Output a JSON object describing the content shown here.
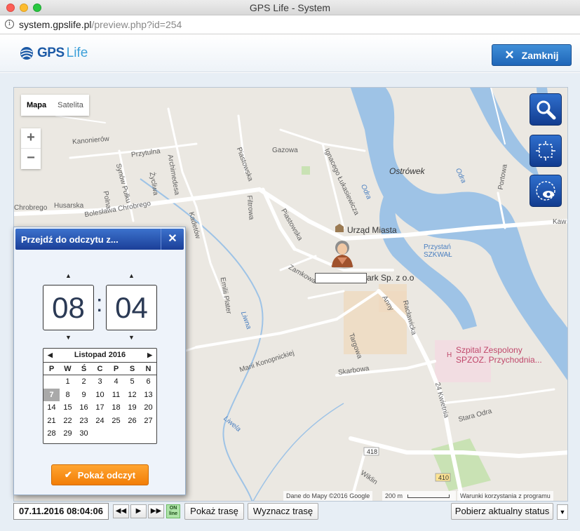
{
  "window": {
    "title": "GPS Life - System"
  },
  "browser": {
    "url_host": "system.gpslife.pl",
    "url_path": "/preview.php?id=254"
  },
  "header": {
    "logo_gps": "GPS",
    "logo_life": "Life",
    "close_label": "Zamknij"
  },
  "map": {
    "type_tabs": [
      "Mapa",
      "Satelita"
    ],
    "active_tab": "Mapa",
    "zoom_in": "+",
    "zoom_out": "−",
    "labels": {
      "kanonierow": "Kanonierów",
      "przytulna": "Przytulna",
      "archimedesa": "Archimedesa",
      "synow_pulku": "Synów Pułku",
      "zycliwa": "Życliwa",
      "piastowska": "Piastowska",
      "gazowa": "Gazowa",
      "ignacego": "Ignacego Łukasiewicza",
      "ostrowek": "Ostrówek",
      "odra": "Odra",
      "odra2": "Odra",
      "portowa": "Portowa",
      "chrobrego": "Chrobrego",
      "husarska": "Husarska",
      "polna": "Polna",
      "boleslawa": "Bolesława Chrobrego",
      "filtrowa": "Filtrowa",
      "kadetow": "Kadetów",
      "piastowska2": "Piastowska",
      "urzad": "Urząd Miasta",
      "przystan": "Przystań",
      "szkwal": "SZKWAŁ",
      "zamkowa": "Zamkowa",
      "park": "ark Sp. z o.o",
      "anny": "Anny",
      "raclawicka": "Racławicka",
      "emilii": "Emilii Plater",
      "liwna": "Liwna",
      "maria": "Marii Konopnickiej",
      "targowa": "Targowa",
      "szpital1": "Szpital Zespolony",
      "szpital2": "SPZOZ. Przychodnia...",
      "skarbowa": "Skarbowa",
      "kwietnia": "24 Kwietnia",
      "stara_odra": "Stara Odra",
      "liwela": "Liwela",
      "wiklinowa": "Wiklin",
      "droga418": "418",
      "droga410": "410",
      "kaw": "Kaw"
    },
    "attribution": "Dane do Mapy ©2016 Google",
    "scale": "200 m",
    "terms": "Warunki korzystania z programu",
    "tool_icons": [
      "search-icon",
      "select-area-icon",
      "view-area-icon"
    ],
    "colors": {
      "water": "#9ec3e6",
      "road": "#ffffff",
      "land": "#ebe8e2"
    }
  },
  "panel": {
    "title": "Przejdź do odczytu z...",
    "hour": "08",
    "minute": "04",
    "colon": ":",
    "calendar": {
      "month": "Listopad 2016",
      "weekdays": [
        "P",
        "W",
        "Ś",
        "C",
        "P",
        "S",
        "N"
      ],
      "weeks": [
        [
          "",
          "1",
          "2",
          "3",
          "4",
          "5",
          "6"
        ],
        [
          "7",
          "8",
          "9",
          "10",
          "11",
          "12",
          "13"
        ],
        [
          "14",
          "15",
          "16",
          "17",
          "18",
          "19",
          "20"
        ],
        [
          "21",
          "22",
          "23",
          "24",
          "25",
          "26",
          "27"
        ],
        [
          "28",
          "29",
          "30",
          "",
          "",
          "",
          ""
        ]
      ],
      "selected": "7"
    },
    "show_button": "Pokaż odczyt"
  },
  "bottom": {
    "datetime": "07.11.2016 08:04:06",
    "online_top": "ON",
    "online_bottom": "line",
    "show_route": "Pokaż trasę",
    "plan_route": "Wyznacz trasę",
    "get_status": "Pobierz aktualny status"
  }
}
